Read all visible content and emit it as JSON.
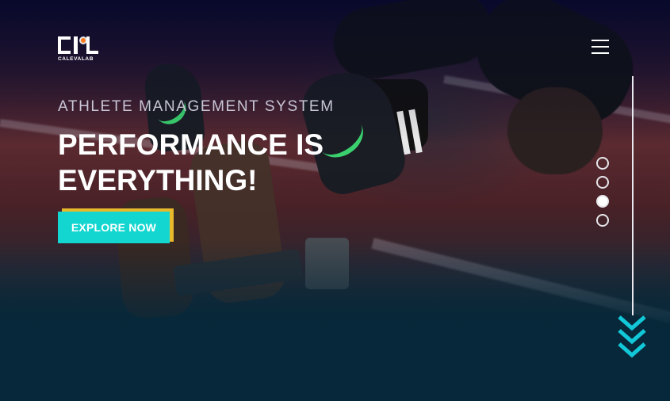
{
  "header": {
    "logo_text": "CALEVALAB",
    "menu_icon": "hamburger-menu-icon"
  },
  "hero": {
    "eyebrow": "ATHLETE MANAGEMENT SYSTEM",
    "headline": "PERFORMANCE IS EVERYTHING!",
    "cta_label": "EXPLORE NOW"
  },
  "pager": {
    "slides": 4,
    "active_index": 3
  },
  "scroll_icon": "scroll-down-chevrons-icon",
  "colors": {
    "accent_cyan": "#12d6cf",
    "accent_gold": "#e9b92c",
    "logo_orange": "#ff7a1a",
    "bottom_background": "#06283a"
  }
}
